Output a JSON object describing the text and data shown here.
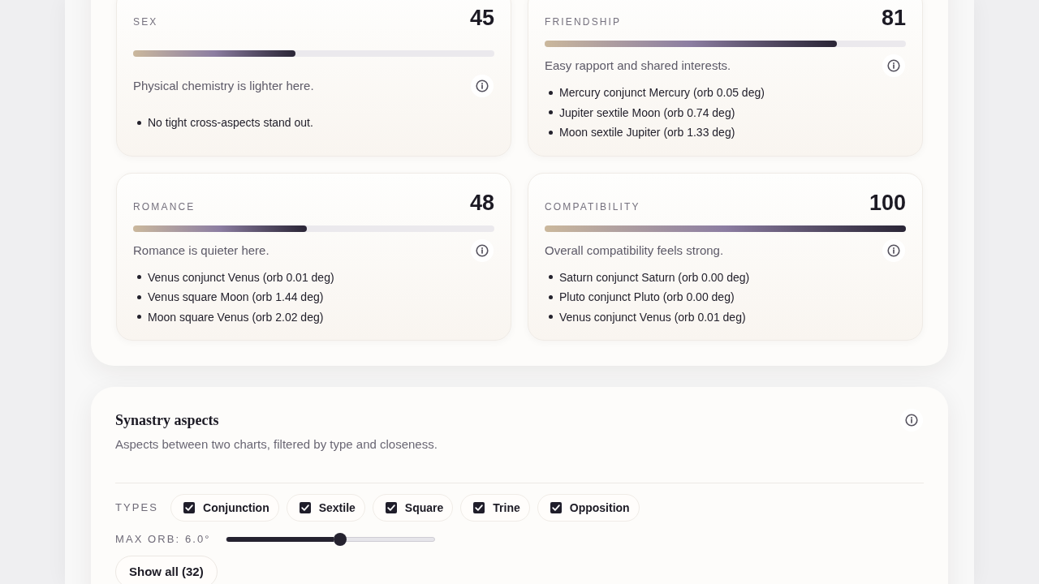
{
  "score_cards": [
    {
      "label": "SEX",
      "score": "45",
      "level": 0.45,
      "summary": "Physical chemistry is lighter here.",
      "aspects": [
        "No tight cross-aspects stand out."
      ]
    },
    {
      "label": "FRIENDSHIP",
      "score": "81",
      "level": 0.81,
      "summary": "Easy rapport and shared interests.",
      "aspects": [
        "Mercury conjunct Mercury (orb 0.05 deg)",
        "Jupiter sextile Moon (orb 0.74 deg)",
        "Moon sextile Jupiter (orb 1.33 deg)"
      ]
    },
    {
      "label": "ROMANCE",
      "score": "48",
      "level": 0.48,
      "summary": "Romance is quieter here.",
      "aspects": [
        "Venus conjunct Venus (orb 0.01 deg)",
        "Venus square Moon (orb 1.44 deg)",
        "Moon square Venus (orb 2.02 deg)"
      ]
    },
    {
      "label": "COMPATIBILITY",
      "score": "100",
      "level": 1.0,
      "summary": "Overall compatibility feels strong.",
      "aspects": [
        "Saturn conjunct Saturn (orb 0.00 deg)",
        "Pluto conjunct Pluto (orb 0.00 deg)",
        "Venus conjunct Venus (orb 0.01 deg)"
      ]
    }
  ],
  "synastry_aspects": {
    "title": "Synastry aspects",
    "subtitle": "Aspects between two charts, filtered by type and closeness.",
    "types_label": "TYPES",
    "types": [
      {
        "label": "Conjunction",
        "checked": true
      },
      {
        "label": "Sextile",
        "checked": true
      },
      {
        "label": "Square",
        "checked": true
      },
      {
        "label": "Trine",
        "checked": true
      },
      {
        "label": "Opposition",
        "checked": true
      }
    ],
    "max_orb": {
      "label": "MAX ORB: 6.0°",
      "level": 0.55
    },
    "show_all_button": "Show all (32)"
  }
}
